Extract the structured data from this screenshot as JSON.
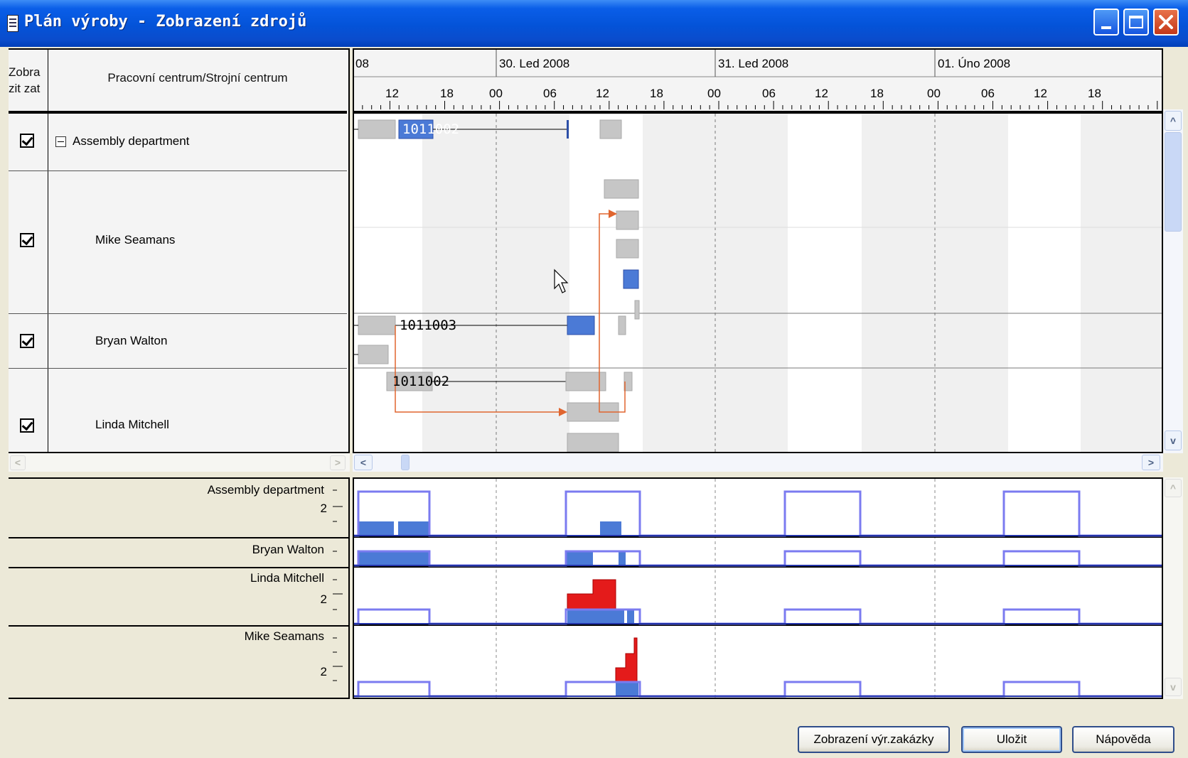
{
  "window": {
    "title": "Plán výroby - Zobrazení zdrojů"
  },
  "grid": {
    "col_show_header": "Zobra\nzit zat",
    "col_center_header": "Pracovní centrum/Strojní centrum",
    "rows": [
      {
        "label": "Assembly department",
        "checked": true,
        "expandable": true
      },
      {
        "label": "Mike Seamans",
        "checked": true
      },
      {
        "label": "Bryan Walton",
        "checked": true
      },
      {
        "label": "Linda Mitchell",
        "checked": true
      }
    ]
  },
  "timeline": {
    "dates": [
      "08",
      "30. Led 2008",
      "31. Led 2008",
      "01. Úno 2008"
    ],
    "hours": [
      "12",
      "18",
      "00",
      "06",
      "12",
      "18",
      "00",
      "06",
      "12",
      "18",
      "00",
      "06",
      "12",
      "18"
    ]
  },
  "gantt": {
    "labels": [
      "1011002",
      "1011003",
      "1011002"
    ]
  },
  "load": {
    "rows": [
      {
        "label": "Assembly department",
        "tick": "2"
      },
      {
        "label": "Bryan Walton",
        "tick": ""
      },
      {
        "label": "Linda Mitchell",
        "tick": "2"
      },
      {
        "label": "Mike Seamans",
        "tick": "2"
      }
    ]
  },
  "buttons": {
    "show_order": "Zobrazení výr.zakázky",
    "save": "Uložit",
    "help": "Nápověda"
  },
  "colors": {
    "titlebar": "#0453d8",
    "bar_grey": "#c6c6c6",
    "bar_blue": "#4b7ad6",
    "capacity_line": "#7b7bf0",
    "overload_red": "#e41b1b",
    "link_arrow": "#e0652f"
  }
}
